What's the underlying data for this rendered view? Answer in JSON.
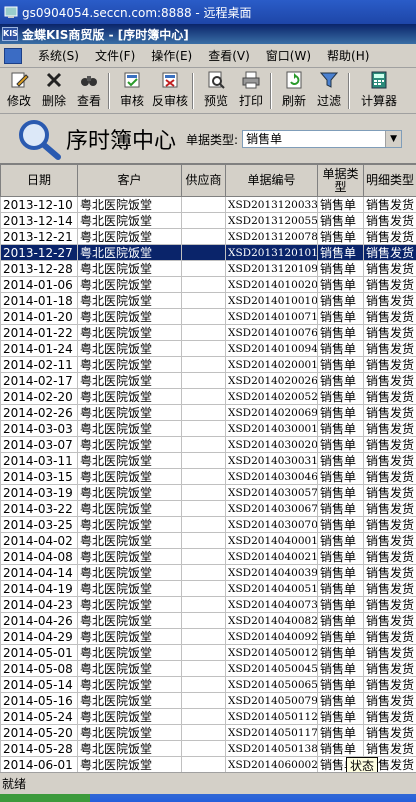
{
  "remote_title": "gs0904054.seccn.com:8888 - 远程桌面",
  "app": {
    "title": "金蝶KIS商贸版 - [序时簿中心]"
  },
  "menu": [
    "系统(S)",
    "文件(F)",
    "操作(E)",
    "查看(V)",
    "窗口(W)",
    "帮助(H)"
  ],
  "toolbar": {
    "modify": "修改",
    "delete": "删除",
    "view": "查看",
    "audit": "审核",
    "unaudit": "反审核",
    "preview": "预览",
    "print": "打印",
    "refresh": "刷新",
    "filter": "过滤",
    "calculator": "计算器"
  },
  "header": {
    "title": "序时簿中心",
    "filter_label": "单据类型:",
    "filter_value": "销售单"
  },
  "columns": [
    "日期",
    "客户",
    "供应商",
    "单据编号",
    "单据类型",
    "明细类型"
  ],
  "rows": [
    {
      "date": "2013-12-10",
      "customer": "粤北医院饭堂",
      "supplier": "",
      "no": "XSD2013120033",
      "type": "销售单",
      "detail": "销售发货"
    },
    {
      "date": "2013-12-14",
      "customer": "粤北医院饭堂",
      "supplier": "",
      "no": "XSD2013120055",
      "type": "销售单",
      "detail": "销售发货"
    },
    {
      "date": "2013-12-21",
      "customer": "粤北医院饭堂",
      "supplier": "",
      "no": "XSD2013120078",
      "type": "销售单",
      "detail": "销售发货"
    },
    {
      "date": "2013-12-27",
      "customer": "粤北医院饭堂",
      "supplier": "",
      "no": "XSD2013120101",
      "type": "销售单",
      "detail": "销售发货"
    },
    {
      "date": "2013-12-28",
      "customer": "粤北医院饭堂",
      "supplier": "",
      "no": "XSD2013120109",
      "type": "销售单",
      "detail": "销售发货"
    },
    {
      "date": "2014-01-06",
      "customer": "粤北医院饭堂",
      "supplier": "",
      "no": "XSD2014010020",
      "type": "销售单",
      "detail": "销售发货"
    },
    {
      "date": "2014-01-18",
      "customer": "粤北医院饭堂",
      "supplier": "",
      "no": "XSD2014010010",
      "type": "销售单",
      "detail": "销售发货"
    },
    {
      "date": "2014-01-20",
      "customer": "粤北医院饭堂",
      "supplier": "",
      "no": "XSD2014010071",
      "type": "销售单",
      "detail": "销售发货"
    },
    {
      "date": "2014-01-22",
      "customer": "粤北医院饭堂",
      "supplier": "",
      "no": "XSD2014010076",
      "type": "销售单",
      "detail": "销售发货"
    },
    {
      "date": "2014-01-24",
      "customer": "粤北医院饭堂",
      "supplier": "",
      "no": "XSD2014010094",
      "type": "销售单",
      "detail": "销售发货"
    },
    {
      "date": "2014-02-11",
      "customer": "粤北医院饭堂",
      "supplier": "",
      "no": "XSD2014020001",
      "type": "销售单",
      "detail": "销售发货"
    },
    {
      "date": "2014-02-17",
      "customer": "粤北医院饭堂",
      "supplier": "",
      "no": "XSD2014020026",
      "type": "销售单",
      "detail": "销售发货"
    },
    {
      "date": "2014-02-20",
      "customer": "粤北医院饭堂",
      "supplier": "",
      "no": "XSD2014020052",
      "type": "销售单",
      "detail": "销售发货"
    },
    {
      "date": "2014-02-26",
      "customer": "粤北医院饭堂",
      "supplier": "",
      "no": "XSD2014020069",
      "type": "销售单",
      "detail": "销售发货"
    },
    {
      "date": "2014-03-03",
      "customer": "粤北医院饭堂",
      "supplier": "",
      "no": "XSD2014030001",
      "type": "销售单",
      "detail": "销售发货"
    },
    {
      "date": "2014-03-07",
      "customer": "粤北医院饭堂",
      "supplier": "",
      "no": "XSD2014030020",
      "type": "销售单",
      "detail": "销售发货"
    },
    {
      "date": "2014-03-11",
      "customer": "粤北医院饭堂",
      "supplier": "",
      "no": "XSD2014030031",
      "type": "销售单",
      "detail": "销售发货"
    },
    {
      "date": "2014-03-15",
      "customer": "粤北医院饭堂",
      "supplier": "",
      "no": "XSD2014030046",
      "type": "销售单",
      "detail": "销售发货"
    },
    {
      "date": "2014-03-19",
      "customer": "粤北医院饭堂",
      "supplier": "",
      "no": "XSD2014030057",
      "type": "销售单",
      "detail": "销售发货"
    },
    {
      "date": "2014-03-22",
      "customer": "粤北医院饭堂",
      "supplier": "",
      "no": "XSD2014030067",
      "type": "销售单",
      "detail": "销售发货"
    },
    {
      "date": "2014-03-25",
      "customer": "粤北医院饭堂",
      "supplier": "",
      "no": "XSD2014030070",
      "type": "销售单",
      "detail": "销售发货"
    },
    {
      "date": "2014-04-02",
      "customer": "粤北医院饭堂",
      "supplier": "",
      "no": "XSD2014040001",
      "type": "销售单",
      "detail": "销售发货"
    },
    {
      "date": "2014-04-08",
      "customer": "粤北医院饭堂",
      "supplier": "",
      "no": "XSD2014040021",
      "type": "销售单",
      "detail": "销售发货"
    },
    {
      "date": "2014-04-14",
      "customer": "粤北医院饭堂",
      "supplier": "",
      "no": "XSD2014040039",
      "type": "销售单",
      "detail": "销售发货"
    },
    {
      "date": "2014-04-19",
      "customer": "粤北医院饭堂",
      "supplier": "",
      "no": "XSD2014040051",
      "type": "销售单",
      "detail": "销售发货"
    },
    {
      "date": "2014-04-23",
      "customer": "粤北医院饭堂",
      "supplier": "",
      "no": "XSD2014040073",
      "type": "销售单",
      "detail": "销售发货"
    },
    {
      "date": "2014-04-26",
      "customer": "粤北医院饭堂",
      "supplier": "",
      "no": "XSD2014040082",
      "type": "销售单",
      "detail": "销售发货"
    },
    {
      "date": "2014-04-29",
      "customer": "粤北医院饭堂",
      "supplier": "",
      "no": "XSD2014040092",
      "type": "销售单",
      "detail": "销售发货"
    },
    {
      "date": "2014-05-01",
      "customer": "粤北医院饭堂",
      "supplier": "",
      "no": "XSD2014050012",
      "type": "销售单",
      "detail": "销售发货"
    },
    {
      "date": "2014-05-08",
      "customer": "粤北医院饭堂",
      "supplier": "",
      "no": "XSD2014050045",
      "type": "销售单",
      "detail": "销售发货"
    },
    {
      "date": "2014-05-14",
      "customer": "粤北医院饭堂",
      "supplier": "",
      "no": "XSD2014050065",
      "type": "销售单",
      "detail": "销售发货"
    },
    {
      "date": "2014-05-16",
      "customer": "粤北医院饭堂",
      "supplier": "",
      "no": "XSD2014050079",
      "type": "销售单",
      "detail": "销售发货"
    },
    {
      "date": "2014-05-24",
      "customer": "粤北医院饭堂",
      "supplier": "",
      "no": "XSD2014050112",
      "type": "销售单",
      "detail": "销售发货"
    },
    {
      "date": "2014-05-20",
      "customer": "粤北医院饭堂",
      "supplier": "",
      "no": "XSD2014050117",
      "type": "销售单",
      "detail": "销售发货"
    },
    {
      "date": "2014-05-28",
      "customer": "粤北医院饭堂",
      "supplier": "",
      "no": "XSD2014050138",
      "type": "销售单",
      "detail": "销售发货"
    },
    {
      "date": "2014-06-01",
      "customer": "粤北医院饭堂",
      "supplier": "",
      "no": "XSD2014060002",
      "type": "销售单",
      "detail": "销售发货"
    }
  ],
  "selected_row": 3,
  "status": "就绪",
  "tooltip": "状态"
}
